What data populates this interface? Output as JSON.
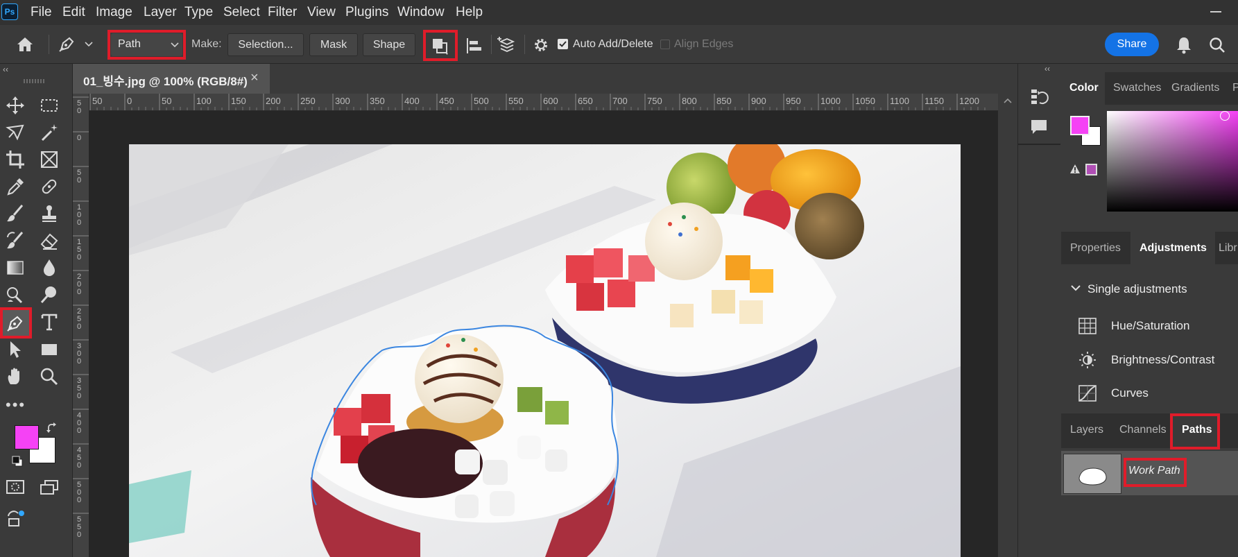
{
  "app": {
    "logo_text": "Ps"
  },
  "menu": [
    "File",
    "Edit",
    "Image",
    "Layer",
    "Type",
    "Select",
    "Filter",
    "View",
    "Plugins",
    "Window",
    "Help"
  ],
  "options": {
    "mode_value": "Path",
    "make_label": "Make:",
    "selection_button": "Selection...",
    "mask_button": "Mask",
    "shape_button": "Shape",
    "auto_add_delete_label": "Auto Add/Delete",
    "auto_add_delete_checked": true,
    "align_edges_label": "Align Edges",
    "align_edges_checked": false,
    "share_button": "Share"
  },
  "document": {
    "tab_title": "01_빙수.jpg @ 100% (RGB/8#)",
    "close_glyph": "×"
  },
  "ruler": {
    "h_ticks": [
      "50",
      "0",
      "50",
      "100",
      "150",
      "200",
      "250",
      "300",
      "350",
      "400",
      "450",
      "500",
      "550",
      "600",
      "650",
      "700",
      "750",
      "800",
      "850",
      "900",
      "950",
      "1000",
      "1050",
      "1100",
      "1150",
      "1200"
    ],
    "v_ticks": [
      "50",
      "0",
      "50",
      "100",
      "150",
      "200",
      "250",
      "300",
      "350",
      "400",
      "450",
      "500",
      "550"
    ]
  },
  "color_panel": {
    "tabs": [
      "Color",
      "Swatches",
      "Gradients",
      "P"
    ],
    "active_tab": "Color",
    "foreground": "#f542f5",
    "background": "#ffffff",
    "gamut_swatch": "#b04fb5"
  },
  "adjustments_panel": {
    "tabs": [
      "Properties",
      "Adjustments",
      "Libr"
    ],
    "active_tab": "Adjustments",
    "section_title": "Single adjustments",
    "items": [
      {
        "label": "Hue/Saturation",
        "icon": "hue-saturation-icon"
      },
      {
        "label": "Brightness/Contrast",
        "icon": "brightness-contrast-icon"
      },
      {
        "label": "Curves",
        "icon": "curves-icon"
      }
    ]
  },
  "paths_panel": {
    "tabs": [
      "Layers",
      "Channels",
      "Paths"
    ],
    "active_tab": "Paths",
    "items": [
      {
        "name": "Work Path"
      }
    ]
  },
  "toolbar": {
    "foreground": "#f542f5",
    "background": "#ffffff"
  },
  "colors": {
    "accent_blue": "#1473e6",
    "highlight_red": "#e01c2a"
  }
}
